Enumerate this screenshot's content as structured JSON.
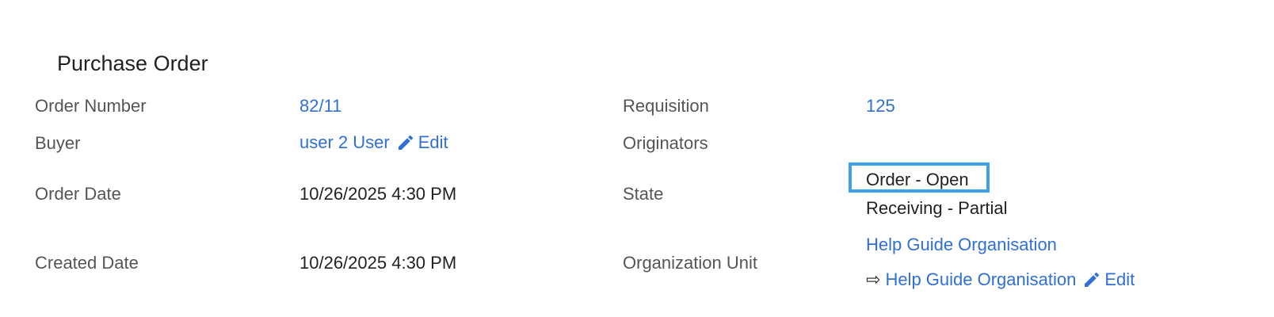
{
  "section_title": "Purchase Order",
  "fields": {
    "order_number": {
      "label": "Order Number",
      "value": "82/11"
    },
    "buyer": {
      "label": "Buyer",
      "value": "user 2 User",
      "edit_label": "Edit"
    },
    "order_date": {
      "label": "Order Date",
      "value": "10/26/2025 4:30 PM"
    },
    "created_date": {
      "label": "Created Date",
      "value": "10/26/2025 4:30 PM"
    },
    "requisition": {
      "label": "Requisition",
      "value": "125"
    },
    "originators": {
      "label": "Originators",
      "value": ""
    },
    "state": {
      "label": "State",
      "primary": "Order - Open",
      "secondary": "Receiving - Partial"
    },
    "organization_unit": {
      "label": "Organization Unit",
      "parent": "Help Guide Organisation",
      "child_arrow": "⇨",
      "child": "Help Guide Organisation",
      "edit_label": "Edit"
    }
  },
  "colors": {
    "link": "#2f6fd6",
    "label": "#555555",
    "value": "#222222",
    "highlight_border": "#3fa0e6"
  },
  "icons": {
    "edit": "pencil-icon"
  }
}
